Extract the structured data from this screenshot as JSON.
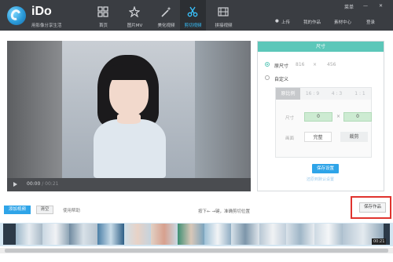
{
  "brand": {
    "name": "iDo",
    "slogan": "用影像分享生活"
  },
  "nav": [
    {
      "label": "首页",
      "icon": "grid-icon"
    },
    {
      "label": "图片MV",
      "icon": "star-figure-icon"
    },
    {
      "label": "美化视频",
      "icon": "magic-wand-icon"
    },
    {
      "label": "剪切视频",
      "icon": "scissors-icon"
    },
    {
      "label": "拼接视频",
      "icon": "film-strip-icon"
    }
  ],
  "window_controls": {
    "menu": "菜单",
    "minimize": "—",
    "close": "✕"
  },
  "top_links": {
    "upload": "上传",
    "my_works": "我的作品",
    "material_center": "素材中心",
    "login": "登录"
  },
  "player": {
    "current_time": "00:00",
    "duration": "00:21"
  },
  "size_panel": {
    "title": "尺寸",
    "options": [
      {
        "label": "原尺寸",
        "width": "816",
        "height": "456",
        "selected": true
      },
      {
        "label": "自定义",
        "selected": false
      }
    ],
    "ratio_tabs": [
      "原比例",
      "16 : 9",
      "4 : 3",
      "1 : 1"
    ],
    "dimension_label": "尺寸",
    "dim_width": "0",
    "dim_height": "0",
    "dim_separator": "×",
    "crop_label": "画面",
    "crop_modes": [
      "完整",
      "裁剪"
    ],
    "save_button": "保存设置",
    "restore_link": "还原到默认设置"
  },
  "toolbar": {
    "add_video": "添加视频",
    "clear": "清空",
    "help": "使用帮助",
    "hint": "按下← →键，准确剪切位置",
    "save_work": "保存作品"
  },
  "timeline": {
    "timecode": "00:21"
  },
  "colors": {
    "accent": "#2ea4e8",
    "panel_header": "#5cc7b9",
    "highlight": "#e0332e",
    "header_bg": "#3a3d42"
  }
}
